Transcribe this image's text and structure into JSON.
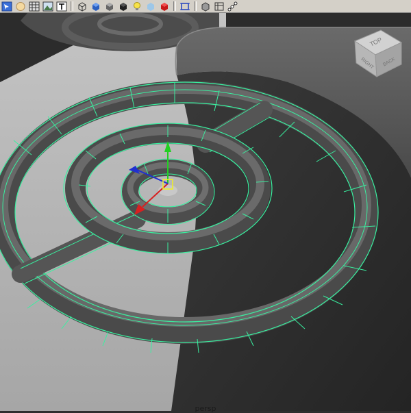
{
  "toolbar": {
    "buttons": [
      {
        "name": "select-icon"
      },
      {
        "name": "sphere-icon"
      },
      {
        "name": "grid-icon"
      },
      {
        "name": "image-icon"
      },
      {
        "name": "text-icon"
      },
      {
        "name": "wireframe-cube-icon"
      },
      {
        "name": "smooth-shade-icon"
      },
      {
        "name": "shade-cube-icon"
      },
      {
        "name": "shadow-cube-icon"
      },
      {
        "name": "light-bulb-icon"
      },
      {
        "name": "xray-icon"
      },
      {
        "name": "render-cube-icon"
      },
      {
        "name": "frame-icon"
      },
      {
        "name": "isolate-icon"
      },
      {
        "name": "camera-attr-icon"
      },
      {
        "name": "joints-icon"
      }
    ]
  },
  "viewcube": {
    "top": "TOP",
    "front": "RIGHT",
    "side": "BACK"
  },
  "viewport": {
    "camera_label": "persp"
  },
  "colors": {
    "wire": "#39f0a0",
    "mesh": "#5a5a5a",
    "floor": "#b4b4b4",
    "toolbar": "#d4d0c8"
  }
}
